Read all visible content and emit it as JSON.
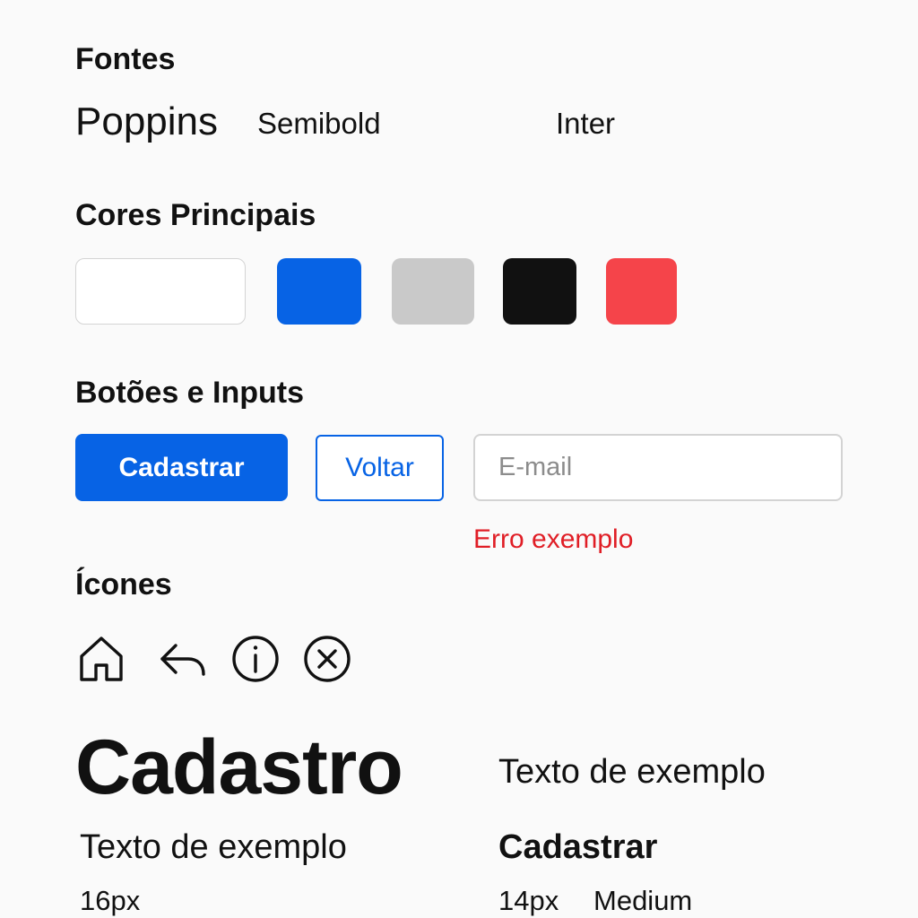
{
  "fonts": {
    "title": "Fontes",
    "primary_name": "Poppins",
    "primary_weight": "Semibold",
    "secondary_name": "Inter"
  },
  "colors": {
    "title": "Cores Principais",
    "swatches": [
      "#ffffff",
      "#0763e5",
      "#c9c9c9",
      "#111111",
      "#f5444a"
    ]
  },
  "controls": {
    "title": "Botões e Inputs",
    "primary_button_label": "Cadastrar",
    "secondary_button_label": "Voltar",
    "email_placeholder": "E-mail",
    "error_message": "Erro exemplo",
    "primary_color": "#0763e5",
    "error_color": "#e01e26"
  },
  "icons": {
    "title": "Ícones",
    "items": [
      "home-icon",
      "back-arrow-icon",
      "info-icon",
      "close-circle-icon"
    ]
  },
  "typography": {
    "heading": "Cadastro",
    "body_large": "Texto de exemplo",
    "body": "Texto de exemplo",
    "body_size": "16px",
    "button_text": "Cadastrar",
    "button_size": "14px",
    "button_weight": "Medium"
  }
}
